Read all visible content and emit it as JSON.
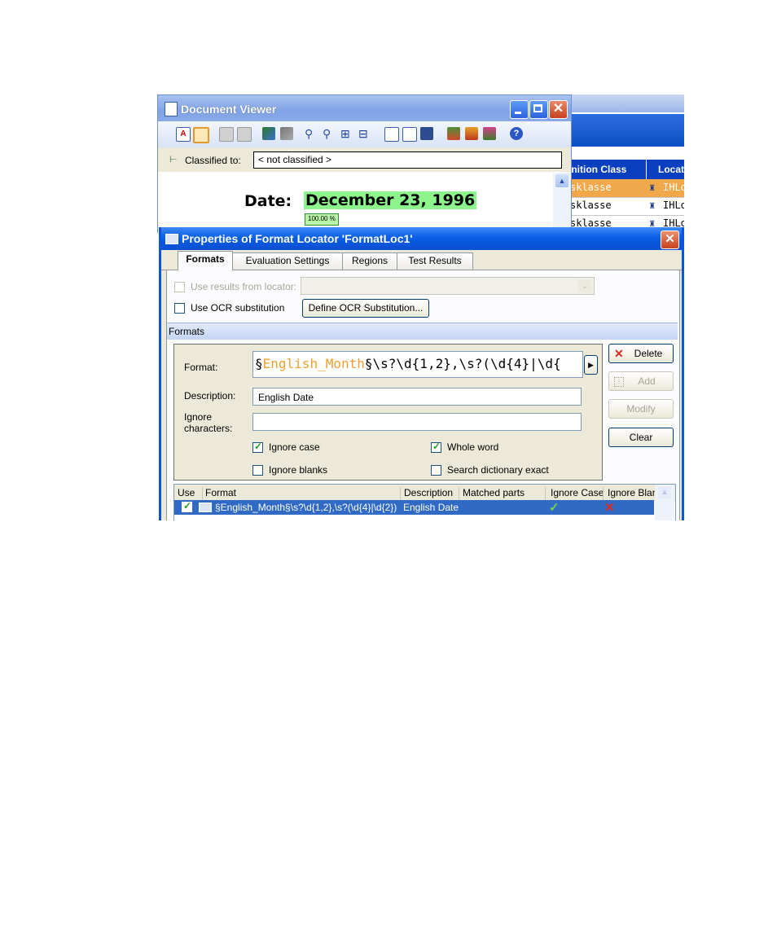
{
  "background_grid": {
    "header": {
      "col1": "inition Class",
      "col2": "Locat"
    },
    "rows": [
      {
        "class": "sklasse",
        "locator": "IHLo",
        "selected": true
      },
      {
        "class": "sklasse",
        "locator": "IHLo",
        "selected": false
      },
      {
        "class": "sklasse",
        "locator": "IHLo",
        "selected": false
      }
    ]
  },
  "document_viewer": {
    "title": "Document Viewer",
    "classified_label": "Classified to:",
    "classified_value": "< not classified >",
    "doc_label": "Date:",
    "doc_value": "December 23, 1996",
    "zoom_badge": "100.00 %"
  },
  "dialog": {
    "title": "Properties of Format Locator 'FormatLoc1'",
    "tabs": [
      "Formats",
      "Evaluation Settings",
      "Regions",
      "Test Results"
    ],
    "use_results_label": "Use results from locator:",
    "use_ocr_label": "Use OCR substitution",
    "define_ocr_button": "Define OCR Substitution...",
    "group_label": "Formats",
    "format_label": "Format:",
    "format_highlight": "English_Month",
    "format_prefix": "§",
    "format_rest": "§\\s?\\d{1,2},\\s?(\\d{4}|\\d{",
    "description_label": "Description:",
    "description_value": "English Date",
    "ignore_chars_label": "Ignore\ncharacters:",
    "ignore_chars_value": "",
    "ignore_case_label": "Ignore case",
    "ignore_case_checked": true,
    "whole_word_label": "Whole word",
    "whole_word_checked": true,
    "ignore_blanks_label": "Ignore blanks",
    "ignore_blanks_checked": false,
    "search_dict_label": "Search dictionary exact",
    "search_dict_checked": false,
    "buttons": {
      "delete": "Delete",
      "add": "Add",
      "modify": "Modify",
      "clear": "Clear"
    },
    "list_headers": [
      "Use",
      "Format",
      "Description",
      "Matched parts",
      "Ignore Case",
      "Ignore Blan"
    ],
    "list_rows": [
      {
        "format": "§English_Month§\\s?\\d{1,2},\\s?(\\d{4}|\\d{2})",
        "description": "English Date",
        "matched_parts": "",
        "ignore_case": true,
        "ignore_blanks": false
      }
    ]
  }
}
